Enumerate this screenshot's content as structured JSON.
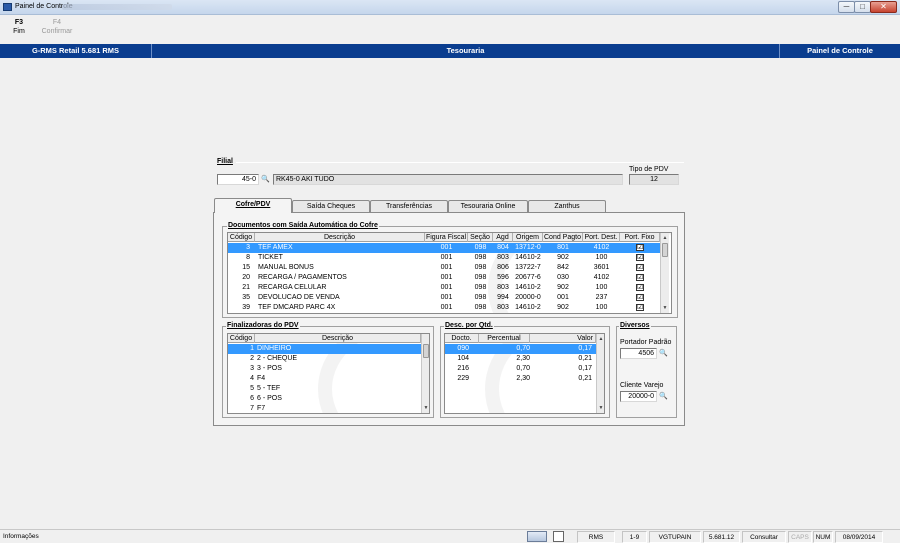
{
  "window": {
    "title": "Painel de Controle",
    "min": "─",
    "max": "□",
    "close": "✕"
  },
  "toolbar": [
    {
      "key": "F3",
      "label": "Fim"
    },
    {
      "key": "F4",
      "label": "Confirmar"
    }
  ],
  "header": {
    "left": "G-RMS Retail 5.681 RMS",
    "center": "Tesouraria",
    "right": "Painel de Controle"
  },
  "filial": {
    "label": "Filial",
    "code": "45-0",
    "name": "RK45-0 AKI TUDO",
    "tipo_label": "Tipo de PDV",
    "tipo_value": "12",
    "search_icon": "binoculars-icon"
  },
  "tabs": [
    {
      "label": "Cofre/PDV",
      "active": true
    },
    {
      "label": "Saída Cheques"
    },
    {
      "label": "Transferências"
    },
    {
      "label": "Tesouraria Online"
    },
    {
      "label": "Zanthus"
    }
  ],
  "documentos": {
    "title": "Documentos com Saída Automática do Cofre",
    "columns": [
      "Código",
      "Descrição",
      "Figura Fiscal",
      "Seção",
      "Agd",
      "Origem",
      "Cond Pagto",
      "Port. Dest.",
      "Port. Fixo"
    ],
    "rows": [
      [
        "3",
        "TEF AMEX",
        "001",
        "098",
        "804",
        "13712-0",
        "801",
        "4102",
        "☑"
      ],
      [
        "8",
        "TICKET",
        "001",
        "098",
        "803",
        "14610-2",
        "902",
        "100",
        "☑"
      ],
      [
        "15",
        "MANUAL BONUS",
        "001",
        "098",
        "806",
        "13722-7",
        "842",
        "3601",
        "☑"
      ],
      [
        "20",
        "RECARGA / PAGAMENTOS",
        "001",
        "098",
        "596",
        "20677-6",
        "030",
        "4102",
        "☑"
      ],
      [
        "21",
        "RECARGA CELULAR",
        "001",
        "098",
        "803",
        "14610-2",
        "902",
        "100",
        "☑"
      ],
      [
        "35",
        "DEVOLUCAO DE VENDA",
        "001",
        "098",
        "994",
        "20000-0",
        "001",
        "237",
        "☑"
      ],
      [
        "39",
        "TEF DMCARD PARC 4X",
        "001",
        "098",
        "803",
        "14610-2",
        "902",
        "100",
        "☑"
      ]
    ]
  },
  "finalizadoras": {
    "title": "Finalizadoras do PDV",
    "columns": [
      "Código",
      "Descrição"
    ],
    "rows": [
      [
        "1",
        "DINHEIRO"
      ],
      [
        "2",
        "2 - CHEQUE"
      ],
      [
        "3",
        "3 - POS"
      ],
      [
        "4",
        "F4"
      ],
      [
        "5",
        "5 - TEF"
      ],
      [
        "6",
        "6 - POS"
      ],
      [
        "7",
        "F7"
      ]
    ]
  },
  "desc_qtd": {
    "title": "Desc. por Qtd.",
    "columns": [
      "Docto.",
      "Percentual",
      "Valor"
    ],
    "rows": [
      [
        "090",
        "0,70",
        "0,17"
      ],
      [
        "104",
        "2,30",
        "0,21"
      ],
      [
        "216",
        "0,70",
        "0,17"
      ],
      [
        "229",
        "2,30",
        "0,21"
      ]
    ]
  },
  "diversos": {
    "title": "Diversos",
    "portador_label": "Portador Padrão",
    "portador_value": "4506",
    "cliente_label": "Cliente Varejo",
    "cliente_value": "20000-0"
  },
  "status": {
    "left": "Informações",
    "app": "RMS",
    "range": "1-9",
    "user": "VGTUPAIN",
    "version": "5.681.12",
    "mode": "Consultar",
    "caps": "CAPS",
    "num": "NUM",
    "date": "08/09/2014"
  },
  "colors": {
    "header_bg": "#0a3d8f",
    "selection": "#3399ff"
  }
}
